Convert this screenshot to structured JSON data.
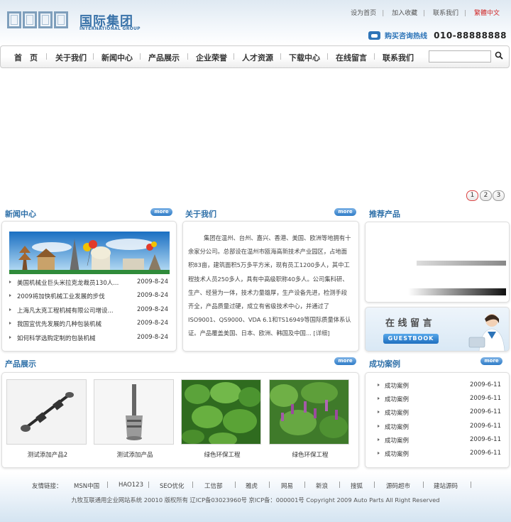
{
  "header": {
    "brand_en": "INTERNATIONAL GROUP",
    "brand_cn": "国际集团",
    "top_links": [
      "设为首页",
      "加入收藏",
      "联系我们"
    ],
    "traditional_link": "繁體中文",
    "hotline_label": "购买咨询热线",
    "hotline_number": "010-88888888"
  },
  "nav": {
    "items": [
      "首　页",
      "关于我们",
      "新闻中心",
      "产品展示",
      "企业荣誉",
      "人才资源",
      "下载中心",
      "在线留言",
      "联系我们"
    ]
  },
  "banner": {
    "pages": [
      "1",
      "2",
      "3"
    ]
  },
  "news": {
    "title": "新闻中心",
    "more": "more",
    "items": [
      {
        "title": "美国机械业巨头米拉克龙裁员130人...",
        "date": "2009-8-24"
      },
      {
        "title": "2009将加快机械工业发展的步伐",
        "date": "2009-8-24"
      },
      {
        "title": "上海凡太克工程机械有限公司增设...",
        "date": "2009-8-24"
      },
      {
        "title": "我国宜优先发展的几种包装机械",
        "date": "2009-8-24"
      },
      {
        "title": "如何科学选购定制的包装机械",
        "date": "2009-8-24"
      }
    ]
  },
  "about": {
    "title": "关于我们",
    "more": "more",
    "text": "集团在温州、台州、嘉兴、香港、美国、欧洲等地拥有十余家分公司。总部设在温州市瓯海高新技术产业园区，占地面积83亩，建筑面积5万多平方米，现有员工1200多人，其中工程技术人员250多人，具有中高级职称40多人。公司集科研、生产、经营为一体，技术力量雄厚，生产设备先进，检测手段齐全，产品质量过硬，成立有省级技术中心，并通过了ISO9001、QS9000、VDA 6.1和TS16949等国际质量体系认证。产品覆盖美国、日本、欧洲、韩国及中国...",
    "detail": "[详细]"
  },
  "recommended": {
    "title": "推荐产品"
  },
  "guestbook": {
    "cn": "在 线 留 言",
    "en": "GUESTBOOK"
  },
  "products": {
    "title": "产品展示",
    "more": "more",
    "items": [
      {
        "caption": "测试添加产品2"
      },
      {
        "caption": "测试添加产品"
      },
      {
        "caption": "绿色环保工程"
      },
      {
        "caption": "绿色环保工程"
      }
    ]
  },
  "cases": {
    "title": "成功案例",
    "more": "more",
    "items": [
      {
        "title": "成功案例",
        "date": "2009-6-11"
      },
      {
        "title": "成功案例",
        "date": "2009-6-11"
      },
      {
        "title": "成功案例",
        "date": "2009-6-11"
      },
      {
        "title": "成功案例",
        "date": "2009-6-11"
      },
      {
        "title": "成功案例",
        "date": "2009-6-11"
      },
      {
        "title": "成功案例",
        "date": "2009-6-11"
      }
    ]
  },
  "footer": {
    "links_label": "友情链接：",
    "links": [
      "MSN中国",
      "HAO123",
      "SEO优化",
      "工信部",
      "雅虎",
      "网易",
      "新浪",
      "搜狐",
      "源码超市",
      "建站源码"
    ],
    "copyright": "九牧互联通用企业网站系统 20010 版权所有 辽ICP备03023960号 京ICP备：000001号 Copyright 2009 Auto Parts All Right Reserved"
  },
  "colors": {
    "accent": "#2d6fa8",
    "more_button": "#2f7cc7",
    "highlight": "#d12a2a"
  }
}
